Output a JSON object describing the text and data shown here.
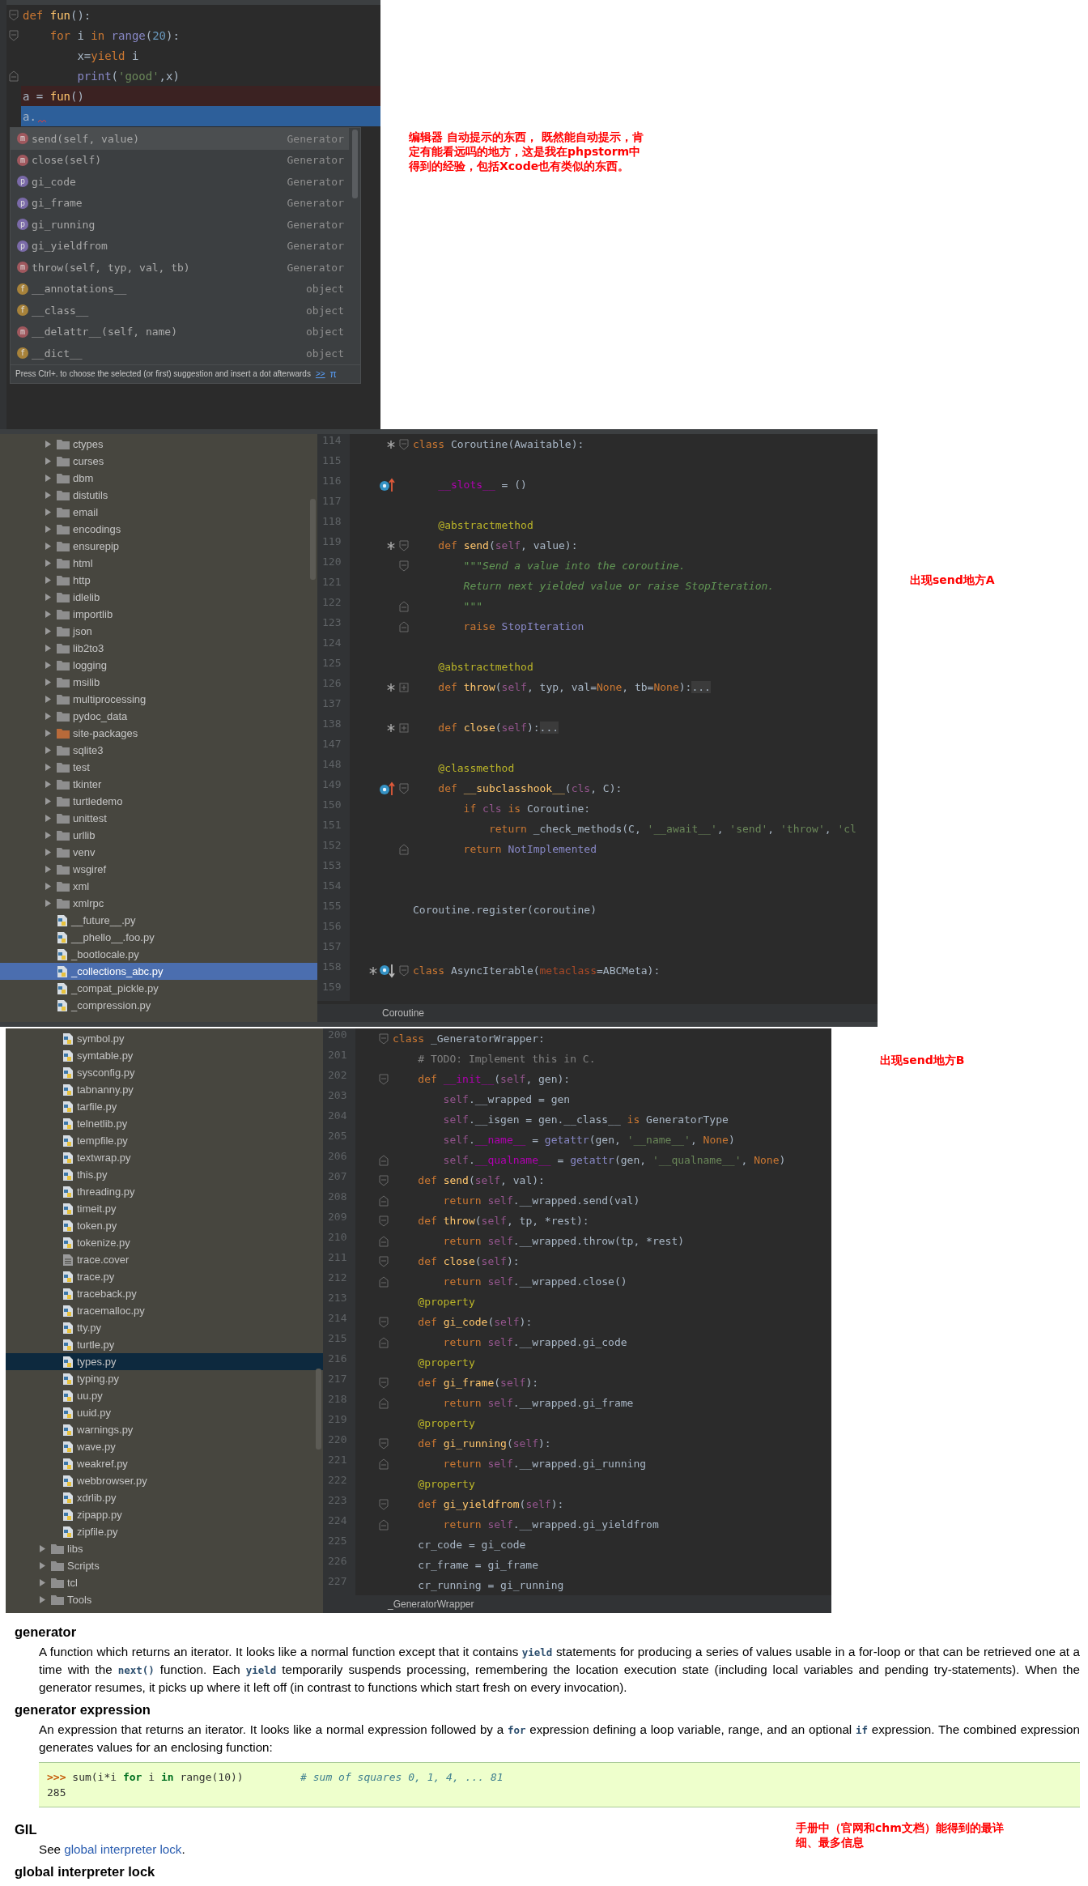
{
  "autocomplete_editor": {
    "lines": [
      {
        "fold": {
          "kind": "start"
        },
        "kind": "normal",
        "tokens": [
          {
            "kind": "kw",
            "text": "def "
          },
          {
            "kind": "fn",
            "text": "fun"
          },
          {
            "kind": "p",
            "text": "():"
          }
        ]
      },
      {
        "fold": {
          "kind": "start"
        },
        "kind": "normal",
        "tokens": [
          {
            "kind": "kw",
            "text": "    for "
          },
          {
            "kind": "p",
            "text": "i "
          },
          {
            "kind": "kw",
            "text": "in "
          },
          {
            "kind": "bi",
            "text": "range"
          },
          {
            "kind": "p",
            "text": "("
          },
          {
            "kind": "num",
            "text": "20"
          },
          {
            "kind": "p",
            "text": "):"
          }
        ]
      },
      {
        "kind": "normal",
        "tokens": [
          {
            "kind": "p",
            "text": "        x="
          },
          {
            "kind": "kw",
            "text": "yield "
          },
          {
            "kind": "p",
            "text": "i"
          }
        ]
      },
      {
        "fold": {
          "kind": "end"
        },
        "kind": "normal",
        "tokens": [
          {
            "kind": "bi",
            "text": "        print"
          },
          {
            "kind": "p",
            "text": "("
          },
          {
            "kind": "str",
            "text": "'good'"
          },
          {
            "kind": "p",
            "text": ",x)"
          }
        ]
      },
      {
        "kind": "error",
        "tokens": [
          {
            "kind": "p",
            "text": "a = "
          },
          {
            "kind": "fn",
            "text": "fun"
          },
          {
            "kind": "p",
            "text": "()"
          }
        ]
      },
      {
        "kind": "caret",
        "tokens": [
          {
            "kind": "p",
            "text": "a."
          }
        ]
      }
    ],
    "popup": {
      "items": [
        {
          "kind": "method",
          "badge": "m",
          "name": "send(self, value)",
          "type": "Generator",
          "selected": true
        },
        {
          "kind": "method",
          "badge": "m",
          "name": "close(self)",
          "type": "Generator",
          "selected": false
        },
        {
          "kind": "property",
          "badge": "p",
          "name": "gi_code",
          "type": "Generator",
          "selected": false
        },
        {
          "kind": "property",
          "badge": "p",
          "name": "gi_frame",
          "type": "Generator",
          "selected": false
        },
        {
          "kind": "property",
          "badge": "p",
          "name": "gi_running",
          "type": "Generator",
          "selected": false
        },
        {
          "kind": "property",
          "badge": "p",
          "name": "gi_yieldfrom",
          "type": "Generator",
          "selected": false
        },
        {
          "kind": "method",
          "badge": "m",
          "name": "throw(self, typ, val, tb)",
          "type": "Generator",
          "selected": false
        },
        {
          "kind": "field",
          "badge": "f",
          "name": "__annotations__",
          "type": "object",
          "selected": false
        },
        {
          "kind": "field",
          "badge": "f",
          "name": "__class__",
          "type": "object",
          "selected": false
        },
        {
          "kind": "method",
          "badge": "m",
          "name": "__delattr__(self, name)",
          "type": "object",
          "selected": false
        },
        {
          "kind": "field",
          "badge": "f",
          "name": "__dict__",
          "type": "object",
          "selected": false
        }
      ],
      "hint": "Press Ctrl+. to choose the selected (or first) suggestion and insert a dot afterwards",
      "hint_link": ">>",
      "hint_icon": "π"
    }
  },
  "note_1": "编辑器 自动提示的东西， 既然能自动提示，肯定有能看远吗的地方，这是我在phpstorm中得到的经验，包括Xcode也有类似的东西。",
  "editor_2": {
    "tree": {
      "items": [
        {
          "kind": "folder",
          "label": "ctypes",
          "expanded": false,
          "selected": false
        },
        {
          "kind": "folder",
          "label": "curses",
          "expanded": false,
          "selected": false
        },
        {
          "kind": "folder",
          "label": "dbm",
          "expanded": false,
          "selected": false
        },
        {
          "kind": "folder",
          "label": "distutils",
          "expanded": false,
          "selected": false
        },
        {
          "kind": "folder",
          "label": "email",
          "expanded": false,
          "selected": false
        },
        {
          "kind": "folder",
          "label": "encodings",
          "expanded": false,
          "selected": false
        },
        {
          "kind": "folder",
          "label": "ensurepip",
          "expanded": false,
          "selected": false
        },
        {
          "kind": "folder",
          "label": "html",
          "expanded": false,
          "selected": false
        },
        {
          "kind": "folder",
          "label": "http",
          "expanded": false,
          "selected": false
        },
        {
          "kind": "folder",
          "label": "idlelib",
          "expanded": false,
          "selected": false
        },
        {
          "kind": "folder",
          "label": "importlib",
          "expanded": false,
          "selected": false
        },
        {
          "kind": "folder",
          "label": "json",
          "expanded": false,
          "selected": false
        },
        {
          "kind": "folder",
          "label": "lib2to3",
          "expanded": false,
          "selected": false
        },
        {
          "kind": "folder",
          "label": "logging",
          "expanded": false,
          "selected": false
        },
        {
          "kind": "folder",
          "label": "msilib",
          "expanded": false,
          "selected": false
        },
        {
          "kind": "folder",
          "label": "multiprocessing",
          "expanded": false,
          "selected": false
        },
        {
          "kind": "folder",
          "label": "pydoc_data",
          "expanded": false,
          "selected": false
        },
        {
          "kind": "package-folder",
          "label": "site-packages",
          "expanded": false,
          "selected": false
        },
        {
          "kind": "folder",
          "label": "sqlite3",
          "expanded": false,
          "selected": false
        },
        {
          "kind": "folder",
          "label": "test",
          "expanded": false,
          "selected": false
        },
        {
          "kind": "folder",
          "label": "tkinter",
          "expanded": false,
          "selected": false
        },
        {
          "kind": "folder",
          "label": "turtledemo",
          "expanded": false,
          "selected": false
        },
        {
          "kind": "folder",
          "label": "unittest",
          "expanded": false,
          "selected": false
        },
        {
          "kind": "folder",
          "label": "urllib",
          "expanded": false,
          "selected": false
        },
        {
          "kind": "folder",
          "label": "venv",
          "expanded": false,
          "selected": false
        },
        {
          "kind": "folder",
          "label": "wsgiref",
          "expanded": false,
          "selected": false
        },
        {
          "kind": "folder",
          "label": "xml",
          "expanded": false,
          "selected": false
        },
        {
          "kind": "folder",
          "label": "xmlrpc",
          "expanded": false,
          "selected": false
        },
        {
          "kind": "python-file",
          "label": "__future__.py",
          "selected": false
        },
        {
          "kind": "python-file",
          "label": "__phello__.foo.py",
          "selected": false
        },
        {
          "kind": "python-file",
          "label": "_bootlocale.py",
          "selected": false
        },
        {
          "kind": "python-file",
          "label": "_collections_abc.py",
          "selected": true
        },
        {
          "kind": "python-file",
          "label": "_compat_pickle.py",
          "selected": false
        },
        {
          "kind": "python-file",
          "label": "_compression.py",
          "selected": false
        }
      ]
    },
    "lines": [
      {
        "num": "114",
        "marks": [
          {
            "kind": "implemented"
          }
        ],
        "fold": {
          "kind": "start"
        },
        "tokens": [
          {
            "kind": "kw",
            "text": "class "
          },
          {
            "kind": "p",
            "text": "Coroutine(Awaitable):"
          }
        ]
      },
      {
        "num": "115"
      },
      {
        "num": "116",
        "marks": [
          {
            "kind": "overrides"
          }
        ],
        "tokens": [
          {
            "kind": "magic",
            "text": "    __slots__"
          },
          {
            "kind": "p",
            "text": " = ()"
          }
        ]
      },
      {
        "num": "117"
      },
      {
        "num": "118",
        "tokens": [
          {
            "kind": "deco",
            "text": "    @abstractmethod"
          }
        ]
      },
      {
        "num": "119",
        "marks": [
          {
            "kind": "implemented"
          }
        ],
        "fold": {
          "kind": "start"
        },
        "tokens": [
          {
            "kind": "kw",
            "text": "    def "
          },
          {
            "kind": "fn",
            "text": "send"
          },
          {
            "kind": "p",
            "text": "("
          },
          {
            "kind": "self",
            "text": "self"
          },
          {
            "kind": "p",
            "text": ", value):"
          }
        ]
      },
      {
        "num": "120",
        "fold": {
          "kind": "start"
        },
        "tokens": [
          {
            "kind": "doc",
            "text": "        \"\"\"Send a value into the coroutine."
          }
        ]
      },
      {
        "num": "121",
        "tokens": [
          {
            "kind": "doc",
            "text": "        Return next yielded value or raise StopIteration."
          }
        ]
      },
      {
        "num": "122",
        "fold": {
          "kind": "end"
        },
        "tokens": [
          {
            "kind": "doc",
            "text": "        \"\"\""
          }
        ]
      },
      {
        "num": "123",
        "fold": {
          "kind": "end"
        },
        "tokens": [
          {
            "kind": "kw",
            "text": "        raise "
          },
          {
            "kind": "bi",
            "text": "StopIteration"
          }
        ]
      },
      {
        "num": "124"
      },
      {
        "num": "125",
        "tokens": [
          {
            "kind": "deco",
            "text": "    @abstractmethod"
          }
        ]
      },
      {
        "num": "126",
        "marks": [
          {
            "kind": "implemented"
          }
        ],
        "fold": {
          "kind": "collapsed"
        },
        "tokens": [
          {
            "kind": "kw",
            "text": "    def "
          },
          {
            "kind": "fn",
            "text": "throw"
          },
          {
            "kind": "p",
            "text": "("
          },
          {
            "kind": "self",
            "text": "self"
          },
          {
            "kind": "p",
            "text": ", typ, val="
          },
          {
            "kind": "kw",
            "text": "None"
          },
          {
            "kind": "p",
            "text": ", tb="
          },
          {
            "kind": "kw",
            "text": "None"
          },
          {
            "kind": "p",
            "text": "):"
          },
          {
            "kind": "fold",
            "text": "..."
          }
        ]
      },
      {
        "num": "137"
      },
      {
        "num": "138",
        "marks": [
          {
            "kind": "implemented"
          }
        ],
        "fold": {
          "kind": "collapsed"
        },
        "tokens": [
          {
            "kind": "kw",
            "text": "    def "
          },
          {
            "kind": "fn",
            "text": "close"
          },
          {
            "kind": "p",
            "text": "("
          },
          {
            "kind": "self",
            "text": "self"
          },
          {
            "kind": "p",
            "text": "):"
          },
          {
            "kind": "fold",
            "text": "..."
          }
        ]
      },
      {
        "num": "147"
      },
      {
        "num": "148",
        "tokens": [
          {
            "kind": "deco",
            "text": "    @classmethod"
          }
        ]
      },
      {
        "num": "149",
        "marks": [
          {
            "kind": "overrides"
          }
        ],
        "fold": {
          "kind": "start"
        },
        "tokens": [
          {
            "kind": "kw",
            "text": "    def "
          },
          {
            "kind": "fn",
            "text": "__subclasshook__"
          },
          {
            "kind": "p",
            "text": "("
          },
          {
            "kind": "self",
            "text": "cls"
          },
          {
            "kind": "p",
            "text": ", C):"
          }
        ]
      },
      {
        "num": "150",
        "tokens": [
          {
            "kind": "kw",
            "text": "        if "
          },
          {
            "kind": "self",
            "text": "cls"
          },
          {
            "kind": "kw",
            "text": " is "
          },
          {
            "kind": "p",
            "text": "Coroutine:"
          }
        ]
      },
      {
        "num": "151",
        "tokens": [
          {
            "kind": "kw",
            "text": "            return "
          },
          {
            "kind": "p",
            "text": "_check_methods(C, "
          },
          {
            "kind": "str",
            "text": "'__await__'"
          },
          {
            "kind": "p",
            "text": ", "
          },
          {
            "kind": "str",
            "text": "'send'"
          },
          {
            "kind": "p",
            "text": ", "
          },
          {
            "kind": "str",
            "text": "'throw'"
          },
          {
            "kind": "p",
            "text": ", "
          },
          {
            "kind": "str",
            "text": "'cl"
          }
        ]
      },
      {
        "num": "152",
        "fold": {
          "kind": "end"
        },
        "tokens": [
          {
            "kind": "kw",
            "text": "        return "
          },
          {
            "kind": "bi",
            "text": "NotImplemented"
          }
        ]
      },
      {
        "num": "153"
      },
      {
        "num": "154"
      },
      {
        "num": "155",
        "tokens": [
          {
            "kind": "p",
            "text": "Coroutine.register(coroutine)"
          }
        ]
      },
      {
        "num": "156"
      },
      {
        "num": "157"
      },
      {
        "num": "158",
        "marks": [
          {
            "kind": "implemented"
          },
          {
            "kind": "overridden"
          }
        ],
        "fold": {
          "kind": "start"
        },
        "tokens": [
          {
            "kind": "kw",
            "text": "class "
          },
          {
            "kind": "p",
            "text": "AsyncIterable("
          },
          {
            "kind": "param",
            "text": "metaclass"
          },
          {
            "kind": "p",
            "text": "=ABCMeta):"
          }
        ]
      },
      {
        "num": "159"
      }
    ],
    "breadcrumb": "Coroutine"
  },
  "note_2": "出现send地方A",
  "editor_3": {
    "tree": {
      "items": [
        {
          "kind": "group",
          "children": [
            {
              "kind": "python-file",
              "label": "symbol.py",
              "selected": false
            },
            {
              "kind": "python-file",
              "label": "symtable.py",
              "selected": false
            },
            {
              "kind": "python-file",
              "label": "sysconfig.py",
              "selected": false
            },
            {
              "kind": "python-file",
              "label": "tabnanny.py",
              "selected": false
            },
            {
              "kind": "python-file",
              "label": "tarfile.py",
              "selected": false
            },
            {
              "kind": "python-file",
              "label": "telnetlib.py",
              "selected": false
            },
            {
              "kind": "python-file",
              "label": "tempfile.py",
              "selected": false
            },
            {
              "kind": "python-file",
              "label": "textwrap.py",
              "selected": false
            },
            {
              "kind": "python-file",
              "label": "this.py",
              "selected": false
            },
            {
              "kind": "python-file",
              "label": "threading.py",
              "selected": false
            },
            {
              "kind": "python-file",
              "label": "timeit.py",
              "selected": false
            },
            {
              "kind": "python-file",
              "label": "token.py",
              "selected": false
            },
            {
              "kind": "python-file",
              "label": "tokenize.py",
              "selected": false
            },
            {
              "kind": "text-file",
              "label": "trace.cover",
              "selected": false
            },
            {
              "kind": "python-file",
              "label": "trace.py",
              "selected": false
            },
            {
              "kind": "python-file",
              "label": "traceback.py",
              "selected": false
            },
            {
              "kind": "python-file",
              "label": "tracemalloc.py",
              "selected": false
            },
            {
              "kind": "python-file",
              "label": "tty.py",
              "selected": false
            },
            {
              "kind": "python-file",
              "label": "turtle.py",
              "selected": false
            },
            {
              "kind": "python-file",
              "label": "types.py",
              "selected": true
            },
            {
              "kind": "python-file",
              "label": "typing.py",
              "selected": false
            },
            {
              "kind": "python-file",
              "label": "uu.py",
              "selected": false
            },
            {
              "kind": "python-file",
              "label": "uuid.py",
              "selected": false
            },
            {
              "kind": "python-file",
              "label": "warnings.py",
              "selected": false
            },
            {
              "kind": "python-file",
              "label": "wave.py",
              "selected": false
            },
            {
              "kind": "python-file",
              "label": "weakref.py",
              "selected": false
            },
            {
              "kind": "python-file",
              "label": "webbrowser.py",
              "selected": false
            },
            {
              "kind": "python-file",
              "label": "xdrlib.py",
              "selected": false
            },
            {
              "kind": "python-file",
              "label": "zipapp.py",
              "selected": false
            },
            {
              "kind": "python-file",
              "label": "zipfile.py",
              "selected": false
            }
          ]
        },
        {
          "kind": "folder",
          "label": "libs",
          "expanded": false,
          "selected": false
        },
        {
          "kind": "folder",
          "label": "Scripts",
          "expanded": false,
          "selected": false
        },
        {
          "kind": "folder",
          "label": "tcl",
          "expanded": false,
          "selected": false
        },
        {
          "kind": "folder",
          "label": "Tools",
          "expanded": false,
          "selected": false
        }
      ]
    },
    "lines": [
      {
        "num": "200",
        "fold": {
          "kind": "start"
        },
        "tokens": [
          {
            "kind": "kw",
            "text": "class "
          },
          {
            "kind": "p",
            "text": "_GeneratorWrapper:"
          }
        ]
      },
      {
        "num": "201",
        "tokens": [
          {
            "kind": "com",
            "text": "    # TODO: Implement this in C."
          }
        ]
      },
      {
        "num": "202",
        "fold": {
          "kind": "start"
        },
        "tokens": [
          {
            "kind": "kw",
            "text": "    def "
          },
          {
            "kind": "magic",
            "text": "__init__"
          },
          {
            "kind": "p",
            "text": "("
          },
          {
            "kind": "self",
            "text": "self"
          },
          {
            "kind": "p",
            "text": ", gen):"
          }
        ]
      },
      {
        "num": "203",
        "tokens": [
          {
            "kind": "self",
            "text": "        self"
          },
          {
            "kind": "p",
            "text": ".__wrapped = gen"
          }
        ]
      },
      {
        "num": "204",
        "tokens": [
          {
            "kind": "self",
            "text": "        self"
          },
          {
            "kind": "p",
            "text": ".__isgen = gen.__class__ "
          },
          {
            "kind": "kw",
            "text": "is "
          },
          {
            "kind": "p",
            "text": "GeneratorType"
          }
        ]
      },
      {
        "num": "205",
        "tokens": [
          {
            "kind": "self",
            "text": "        self"
          },
          {
            "kind": "p",
            "text": "."
          },
          {
            "kind": "magic",
            "text": "__name__"
          },
          {
            "kind": "p",
            "text": " = "
          },
          {
            "kind": "bi",
            "text": "getattr"
          },
          {
            "kind": "p",
            "text": "(gen, "
          },
          {
            "kind": "str",
            "text": "'__name__'"
          },
          {
            "kind": "p",
            "text": ", "
          },
          {
            "kind": "kw",
            "text": "None"
          },
          {
            "kind": "p",
            "text": ")"
          }
        ]
      },
      {
        "num": "206",
        "fold": {
          "kind": "end"
        },
        "tokens": [
          {
            "kind": "self",
            "text": "        self"
          },
          {
            "kind": "p",
            "text": "."
          },
          {
            "kind": "magic",
            "text": "__qualname__"
          },
          {
            "kind": "p",
            "text": " = "
          },
          {
            "kind": "bi",
            "text": "getattr"
          },
          {
            "kind": "p",
            "text": "(gen, "
          },
          {
            "kind": "str",
            "text": "'__qualname__'"
          },
          {
            "kind": "p",
            "text": ", "
          },
          {
            "kind": "kw",
            "text": "None"
          },
          {
            "kind": "p",
            "text": ")"
          }
        ]
      },
      {
        "num": "207",
        "fold": {
          "kind": "start"
        },
        "tokens": [
          {
            "kind": "kw",
            "text": "    def "
          },
          {
            "kind": "fn",
            "text": "send"
          },
          {
            "kind": "p",
            "text": "("
          },
          {
            "kind": "self",
            "text": "self"
          },
          {
            "kind": "p",
            "text": ", val):"
          }
        ]
      },
      {
        "num": "208",
        "fold": {
          "kind": "end"
        },
        "tokens": [
          {
            "kind": "kw",
            "text": "        return "
          },
          {
            "kind": "self",
            "text": "self"
          },
          {
            "kind": "p",
            "text": ".__wrapped.send(val)"
          }
        ]
      },
      {
        "num": "209",
        "fold": {
          "kind": "start"
        },
        "tokens": [
          {
            "kind": "kw",
            "text": "    def "
          },
          {
            "kind": "fn",
            "text": "throw"
          },
          {
            "kind": "p",
            "text": "("
          },
          {
            "kind": "self",
            "text": "self"
          },
          {
            "kind": "p",
            "text": ", tp, *rest):"
          }
        ]
      },
      {
        "num": "210",
        "fold": {
          "kind": "end"
        },
        "tokens": [
          {
            "kind": "kw",
            "text": "        return "
          },
          {
            "kind": "self",
            "text": "self"
          },
          {
            "kind": "p",
            "text": ".__wrapped.throw(tp, *rest)"
          }
        ]
      },
      {
        "num": "211",
        "fold": {
          "kind": "start"
        },
        "tokens": [
          {
            "kind": "kw",
            "text": "    def "
          },
          {
            "kind": "fn",
            "text": "close"
          },
          {
            "kind": "p",
            "text": "("
          },
          {
            "kind": "self",
            "text": "self"
          },
          {
            "kind": "p",
            "text": "):"
          }
        ]
      },
      {
        "num": "212",
        "fold": {
          "kind": "end"
        },
        "tokens": [
          {
            "kind": "kw",
            "text": "        return "
          },
          {
            "kind": "self",
            "text": "self"
          },
          {
            "kind": "p",
            "text": ".__wrapped.close()"
          }
        ]
      },
      {
        "num": "213",
        "tokens": [
          {
            "kind": "deco",
            "text": "    @property"
          }
        ]
      },
      {
        "num": "214",
        "fold": {
          "kind": "start"
        },
        "tokens": [
          {
            "kind": "kw",
            "text": "    def "
          },
          {
            "kind": "fn",
            "text": "gi_code"
          },
          {
            "kind": "p",
            "text": "("
          },
          {
            "kind": "self",
            "text": "self"
          },
          {
            "kind": "p",
            "text": "):"
          }
        ]
      },
      {
        "num": "215",
        "fold": {
          "kind": "end"
        },
        "tokens": [
          {
            "kind": "kw",
            "text": "        return "
          },
          {
            "kind": "self",
            "text": "self"
          },
          {
            "kind": "p",
            "text": ".__wrapped.gi_code"
          }
        ]
      },
      {
        "num": "216",
        "tokens": [
          {
            "kind": "deco",
            "text": "    @property"
          }
        ]
      },
      {
        "num": "217",
        "fold": {
          "kind": "start"
        },
        "tokens": [
          {
            "kind": "kw",
            "text": "    def "
          },
          {
            "kind": "fn",
            "text": "gi_frame"
          },
          {
            "kind": "p",
            "text": "("
          },
          {
            "kind": "self",
            "text": "self"
          },
          {
            "kind": "p",
            "text": "):"
          }
        ]
      },
      {
        "num": "218",
        "fold": {
          "kind": "end"
        },
        "tokens": [
          {
            "kind": "kw",
            "text": "        return "
          },
          {
            "kind": "self",
            "text": "self"
          },
          {
            "kind": "p",
            "text": ".__wrapped.gi_frame"
          }
        ]
      },
      {
        "num": "219",
        "tokens": [
          {
            "kind": "deco",
            "text": "    @property"
          }
        ]
      },
      {
        "num": "220",
        "fold": {
          "kind": "start"
        },
        "tokens": [
          {
            "kind": "kw",
            "text": "    def "
          },
          {
            "kind": "fn",
            "text": "gi_running"
          },
          {
            "kind": "p",
            "text": "("
          },
          {
            "kind": "self",
            "text": "self"
          },
          {
            "kind": "p",
            "text": "):"
          }
        ]
      },
      {
        "num": "221",
        "fold": {
          "kind": "end"
        },
        "tokens": [
          {
            "kind": "kw",
            "text": "        return "
          },
          {
            "kind": "self",
            "text": "self"
          },
          {
            "kind": "p",
            "text": ".__wrapped.gi_running"
          }
        ]
      },
      {
        "num": "222",
        "tokens": [
          {
            "kind": "deco",
            "text": "    @property"
          }
        ]
      },
      {
        "num": "223",
        "fold": {
          "kind": "start"
        },
        "tokens": [
          {
            "kind": "kw",
            "text": "    def "
          },
          {
            "kind": "fn",
            "text": "gi_yieldfrom"
          },
          {
            "kind": "p",
            "text": "("
          },
          {
            "kind": "self",
            "text": "self"
          },
          {
            "kind": "p",
            "text": "):"
          }
        ]
      },
      {
        "num": "224",
        "fold": {
          "kind": "end"
        },
        "tokens": [
          {
            "kind": "kw",
            "text": "        return "
          },
          {
            "kind": "self",
            "text": "self"
          },
          {
            "kind": "p",
            "text": ".__wrapped.gi_yieldfrom"
          }
        ]
      },
      {
        "num": "225",
        "tokens": [
          {
            "kind": "p",
            "text": "    cr_code = gi_code"
          }
        ]
      },
      {
        "num": "226",
        "tokens": [
          {
            "kind": "p",
            "text": "    cr_frame = gi_frame"
          }
        ]
      },
      {
        "num": "227",
        "tokens": [
          {
            "kind": "p",
            "text": "    cr_running = gi_running"
          }
        ]
      }
    ],
    "breadcrumb": "_GeneratorWrapper"
  },
  "note_3": "出现send地方B",
  "glossary": {
    "entries": [
      {
        "term": "generator",
        "paragraphs": [
          [
            {
              "kind": "text",
              "text": "A function which returns an iterator. It looks like a normal function except that it contains "
            },
            {
              "kind": "code",
              "text": "yield"
            },
            {
              "kind": "text",
              "text": " statements for producing a series of values usable in a for-loop or that can be retrieved one at a time with the "
            },
            {
              "kind": "code",
              "text": "next()"
            },
            {
              "kind": "text",
              "text": " function. Each "
            },
            {
              "kind": "code",
              "text": "yield"
            },
            {
              "kind": "text",
              "text": " temporarily suspends processing, remembering the location execution state (including local variables and pending try-statements). When the generator resumes, it picks up where it left off (in contrast to functions which start fresh on every invocation)."
            }
          ]
        ]
      },
      {
        "term": "generator expression",
        "paragraphs": [
          [
            {
              "kind": "text",
              "text": "An expression that returns an iterator. It looks like a normal expression followed by a "
            },
            {
              "kind": "code",
              "text": "for"
            },
            {
              "kind": "text",
              "text": " expression defining a loop variable, range, and an optional "
            },
            {
              "kind": "code",
              "text": "if"
            },
            {
              "kind": "text",
              "text": " expression. The combined expression generates values for an enclosing function:"
            }
          ]
        ],
        "example": {
          "lines": [
            [
              {
                "kind": "prompt",
                "text": ">>> "
              },
              {
                "kind": "p",
                "text": "sum(i*i "
              },
              {
                "kind": "kw",
                "text": "for"
              },
              {
                "kind": "p",
                "text": " i "
              },
              {
                "kind": "kw",
                "text": "in"
              },
              {
                "kind": "p",
                "text": " range(10))         "
              },
              {
                "kind": "com",
                "text": "# sum of squares 0, 1, 4, ... 81"
              }
            ],
            [
              {
                "kind": "p",
                "text": "285"
              }
            ]
          ]
        }
      },
      {
        "term": "GIL",
        "paragraphs": [
          [
            {
              "kind": "text",
              "text": "See "
            },
            {
              "kind": "link",
              "text": "global interpreter lock"
            },
            {
              "kind": "text",
              "text": "."
            }
          ]
        ]
      },
      {
        "term": "global interpreter lock"
      }
    ]
  },
  "note_4": "手册中（官网和chm文档）能得到的最详细、最多信息"
}
